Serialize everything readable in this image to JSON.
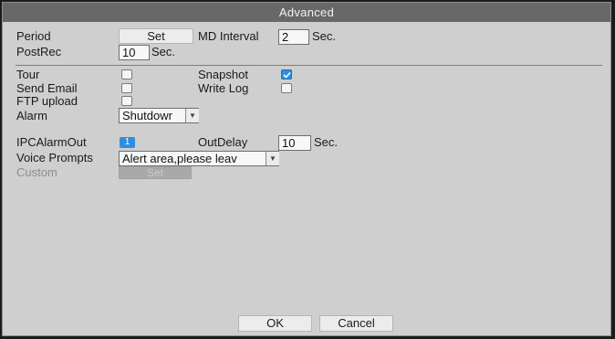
{
  "window": {
    "title": "Advanced"
  },
  "record": {
    "period_label": "Period",
    "period_button": "Set",
    "md_interval_label": "MD Interval",
    "md_interval_value": "2",
    "md_interval_unit": "Sec.",
    "postrec_label": "PostRec",
    "postrec_value": "10",
    "postrec_unit": "Sec."
  },
  "actions": {
    "tour_label": "Tour",
    "tour_checked": false,
    "snapshot_label": "Snapshot",
    "snapshot_checked": true,
    "send_email_label": "Send Email",
    "send_email_checked": false,
    "write_log_label": "Write Log",
    "write_log_checked": false,
    "ftp_upload_label": "FTP upload",
    "ftp_upload_checked": false,
    "alarm_label": "Alarm",
    "alarm_value": "Shutdowr"
  },
  "ipc": {
    "ipc_alarm_out_label": "IPCAlarmOut",
    "ipc_alarm_out_value": "1",
    "out_delay_label": "OutDelay",
    "out_delay_value": "10",
    "out_delay_unit": "Sec.",
    "voice_prompts_label": "Voice Prompts",
    "voice_prompts_value": "Alert area,please leav",
    "custom_label": "Custom",
    "custom_button": "Set"
  },
  "footer": {
    "ok_label": "OK",
    "cancel_label": "Cancel"
  },
  "colors": {
    "accent": "#2f8fde",
    "dialog_bg": "#cfcfcf",
    "titlebar_bg": "#686868"
  }
}
